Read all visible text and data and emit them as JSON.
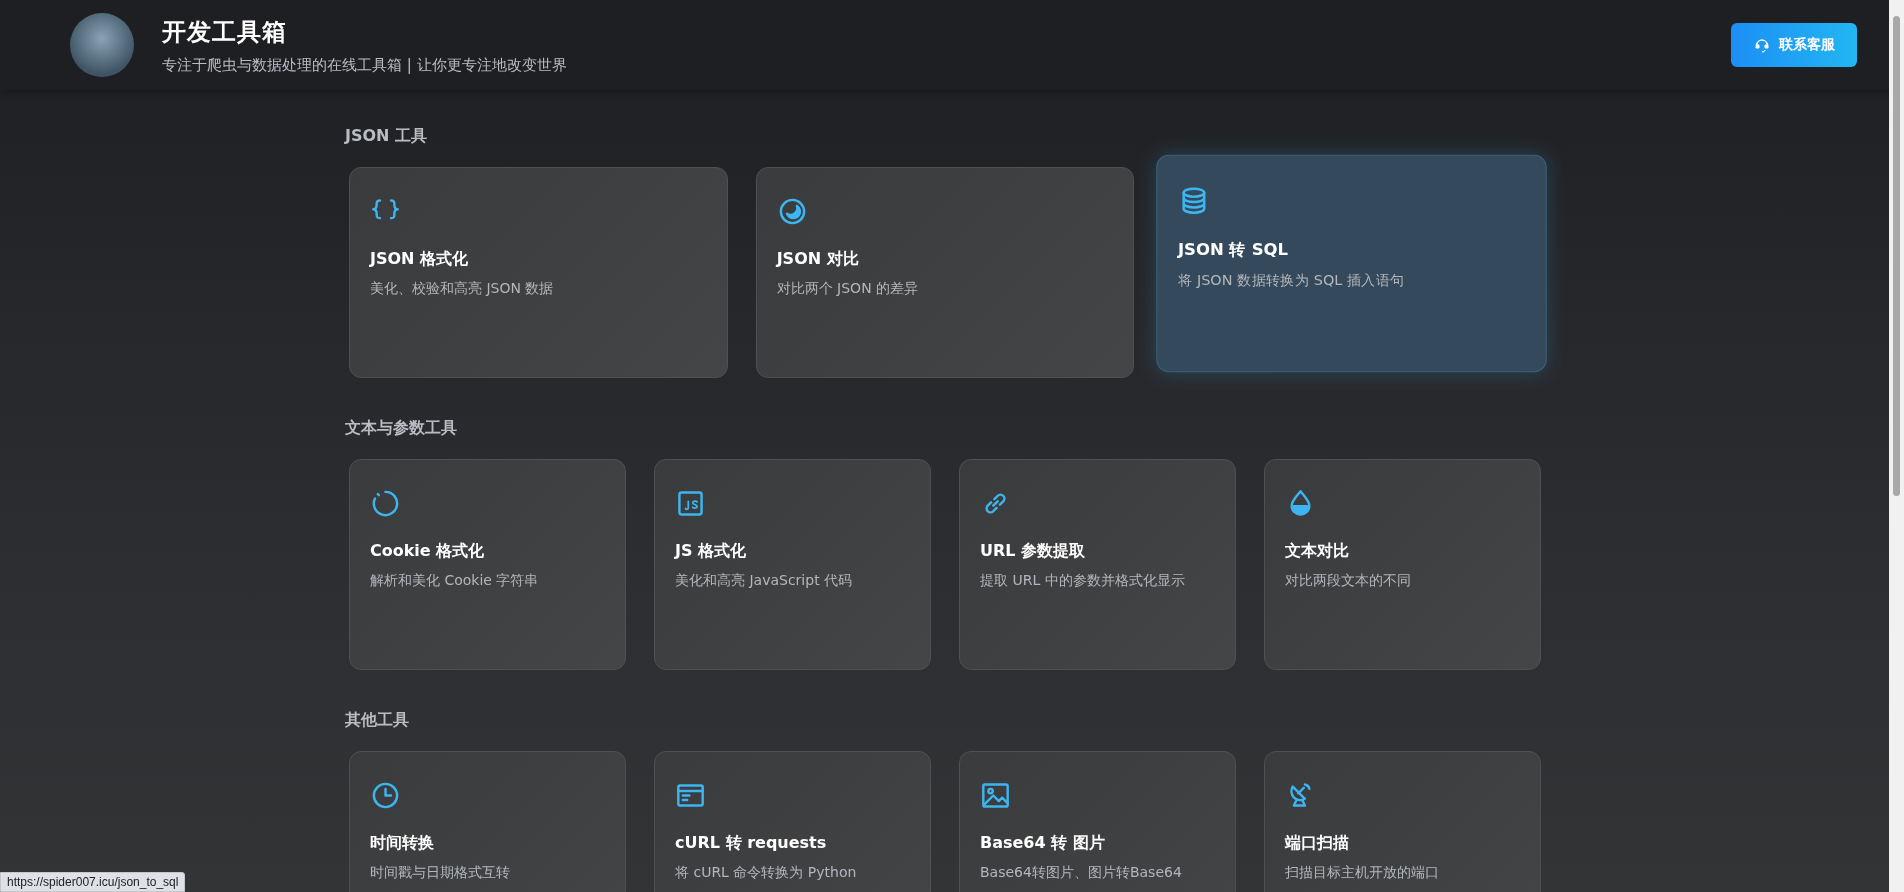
{
  "header": {
    "title": "开发工具箱",
    "subtitle": "专注于爬虫与数据处理的在线工具箱 | 让你更专注地改变世界",
    "contact_button": "联系客服"
  },
  "sections": [
    {
      "title": "JSON 工具",
      "cards": [
        {
          "title": "JSON 格式化",
          "description": "美化、校验和高亮 JSON 数据",
          "hovered": false
        },
        {
          "title": "JSON 对比",
          "description": "对比两个 JSON 的差异",
          "hovered": false
        },
        {
          "title": "JSON 转 SQL",
          "description": "将 JSON 数据转换为 SQL 插入语句",
          "hovered": true
        }
      ]
    },
    {
      "title": "文本与参数工具",
      "cards": [
        {
          "title": "Cookie 格式化",
          "description": "解析和美化 Cookie 字符串",
          "hovered": false
        },
        {
          "title": "JS 格式化",
          "description": "美化和高亮 JavaScript 代码",
          "hovered": false
        },
        {
          "title": "URL 参数提取",
          "description": "提取 URL 中的参数并格式化显示",
          "hovered": false
        },
        {
          "title": "文本对比",
          "description": "对比两段文本的不同",
          "hovered": false
        }
      ]
    },
    {
      "title": "其他工具",
      "cards": [
        {
          "title": "时间转换",
          "description": "时间戳与日期格式互转",
          "hovered": false
        },
        {
          "title": "cURL 转 requests",
          "description": "将 cURL 命令转换为 Python",
          "hovered": false
        },
        {
          "title": "Base64 转 图片",
          "description": "Base64转图片、图片转Base64",
          "hovered": false
        },
        {
          "title": "端口扫描",
          "description": "扫描目标主机开放的端口",
          "hovered": false
        }
      ]
    }
  ],
  "status_link": "https://spider007.icu/json_to_sql"
}
